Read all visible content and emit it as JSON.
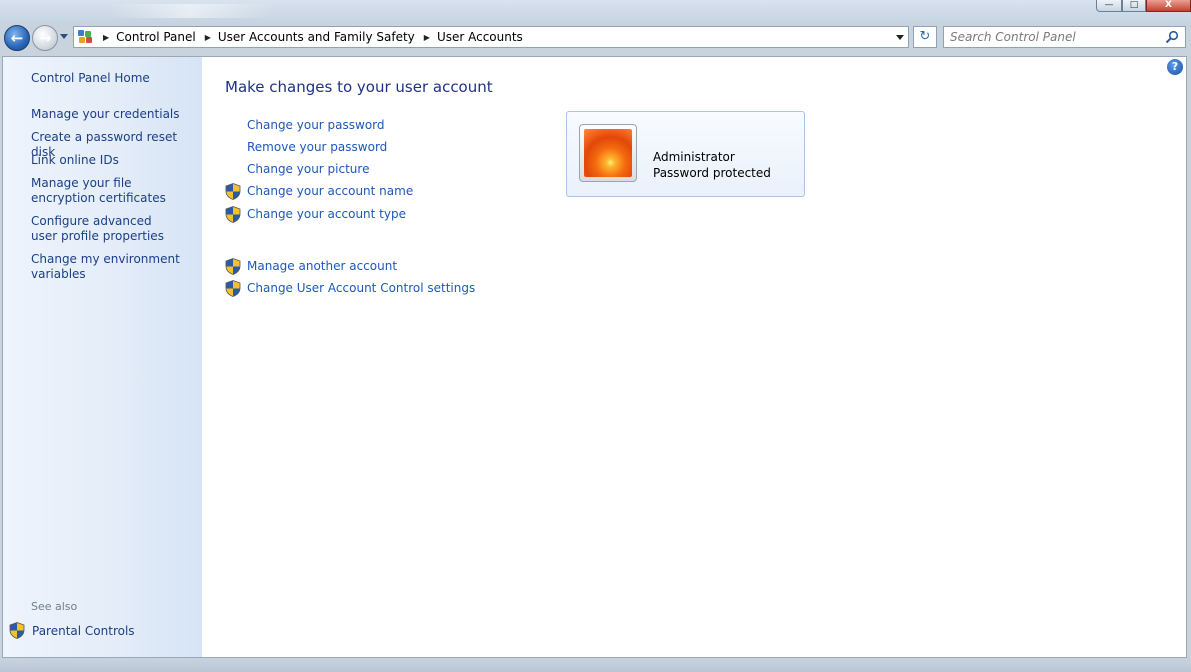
{
  "window": {
    "minimize_glyph": "—",
    "maximize_glyph": "□",
    "close_glyph": "X"
  },
  "navigation": {
    "back_glyph": "←",
    "forward_glyph": "→",
    "breadcrumb_separator": "▶",
    "breadcrumbs": [
      "Control Panel",
      "User Accounts and Family Safety",
      "User Accounts"
    ],
    "refresh_glyph": "↻"
  },
  "search": {
    "placeholder": "Search Control Panel"
  },
  "sidebar": {
    "home": "Control Panel Home",
    "items": [
      "Manage your credentials",
      "Create a password reset disk",
      "Link online IDs",
      "Manage your file encryption certificates",
      "Configure advanced user profile properties",
      "Change my environment variables"
    ],
    "see_also_label": "See also",
    "see_also_items": [
      "Parental Controls"
    ]
  },
  "main": {
    "title": "Make changes to your user account",
    "actions": [
      {
        "label": "Change your password",
        "shield": false
      },
      {
        "label": "Remove your password",
        "shield": false
      },
      {
        "label": "Change your picture",
        "shield": false
      },
      {
        "label": "Change your account name",
        "shield": true
      },
      {
        "label": "Change your account type",
        "shield": true
      }
    ],
    "other_actions": [
      {
        "label": "Manage another account",
        "shield": true
      },
      {
        "label": "Change User Account Control settings",
        "shield": true
      }
    ],
    "help_glyph": "?"
  },
  "user_card": {
    "name": "Administrator",
    "status": "Password protected"
  },
  "colors": {
    "link": "#1e58b8",
    "title": "#1e3287",
    "sidebar_link": "#1b3f85",
    "see_also": "#6f7d8c"
  }
}
